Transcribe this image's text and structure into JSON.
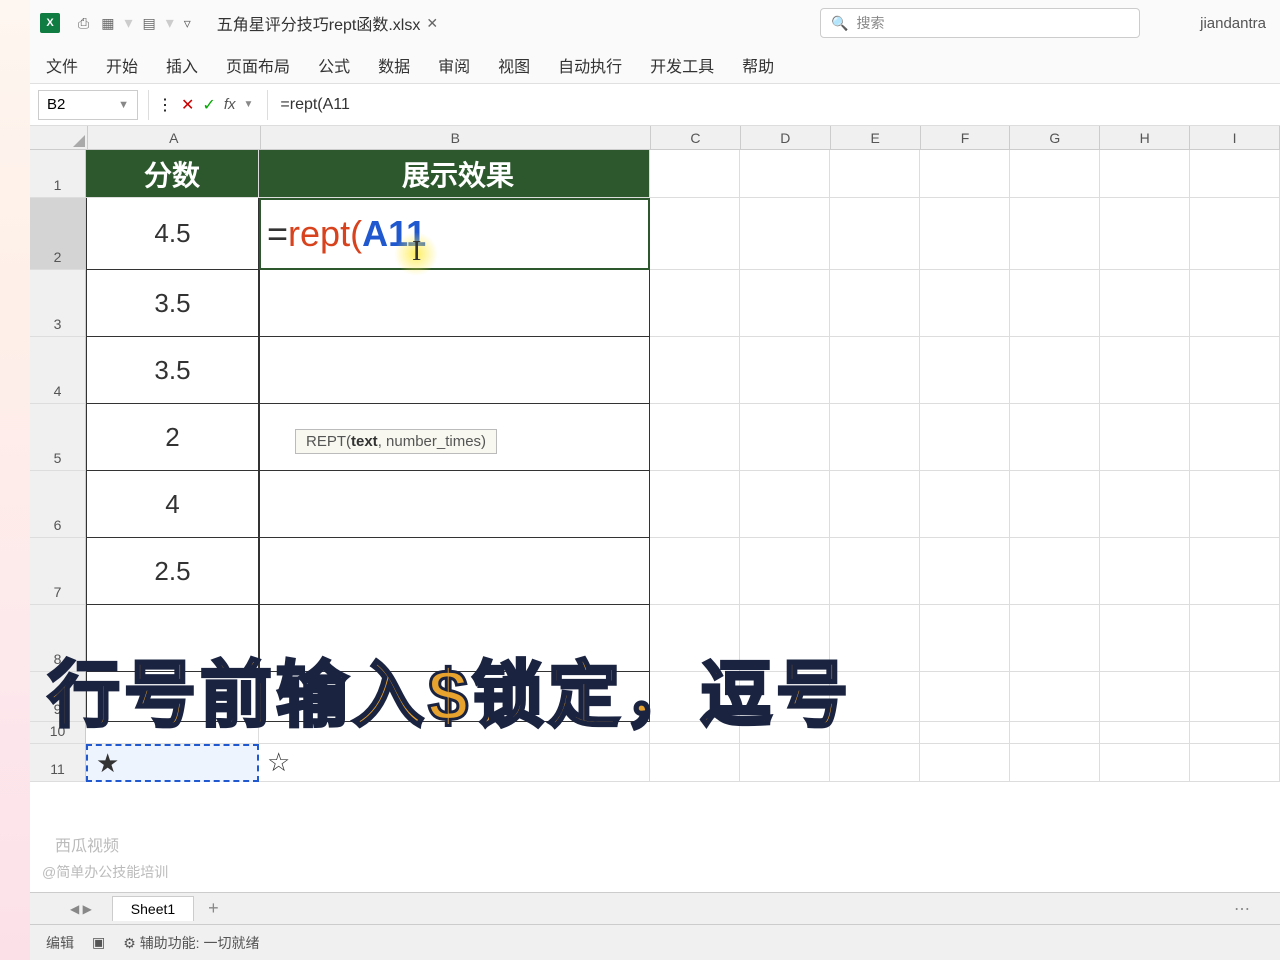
{
  "title_bar": {
    "doc_title": "五角星评分技巧rept函数.xlsx",
    "search_placeholder": "搜索",
    "username": "jiandantra"
  },
  "ribbon": {
    "tabs": [
      "文件",
      "开始",
      "插入",
      "页面布局",
      "公式",
      "数据",
      "审阅",
      "视图",
      "自动执行",
      "开发工具",
      "帮助"
    ]
  },
  "formula_bar": {
    "name_box": "B2",
    "formula": "=rept(A11"
  },
  "columns": [
    "A",
    "B",
    "C",
    "D",
    "E",
    "F",
    "G",
    "H",
    "I"
  ],
  "rows": [
    "1",
    "2",
    "3",
    "4",
    "5",
    "6",
    "7",
    "8",
    "9",
    "10",
    "11"
  ],
  "headers": {
    "colA": "分数",
    "colB": "展示效果"
  },
  "data": {
    "A2": "4.5",
    "A3": "3.5",
    "A4": "3.5",
    "A5": "2",
    "A6": "4",
    "A7": "2.5",
    "A11": "★",
    "B11": "☆"
  },
  "editing": {
    "eq": "=",
    "fn": "rept",
    "paren": "(",
    "ref": "A11"
  },
  "tooltip": {
    "fn": "REPT(",
    "arg1": "text",
    "rest": ", number_times)"
  },
  "caption": "行号前输入$锁定，逗号",
  "sheet_tabs": {
    "active": "Sheet1"
  },
  "status_bar": {
    "mode": "编辑",
    "accessibility": "辅助功能: 一切就绪"
  },
  "watermark": {
    "line1": "西瓜视频",
    "line2": "@简单办公技能培训"
  }
}
